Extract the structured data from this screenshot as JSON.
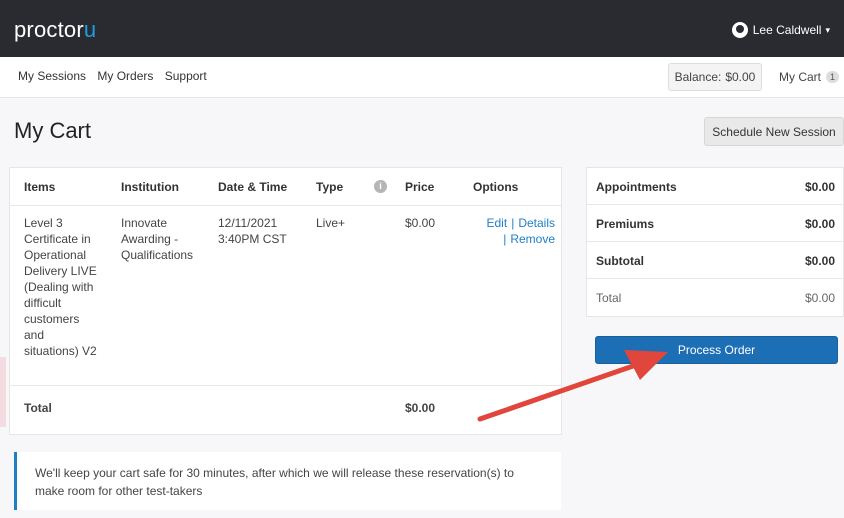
{
  "app": {
    "logo_text": "proctor",
    "logo_mark": "u",
    "user_name": "Lee Caldwell",
    "user_caret": "▾"
  },
  "nav": {
    "items": [
      "My Sessions",
      "My Orders",
      "Support"
    ],
    "balance_label": "Balance:",
    "balance_value": "$0.00",
    "cart_label": "My Cart",
    "cart_count": "1"
  },
  "page": {
    "title": "My Cart",
    "schedule_button": "Schedule New Session"
  },
  "cart_table": {
    "headers": [
      "Items",
      "Institution",
      "Date & Time",
      "Type",
      "Price",
      "Options"
    ],
    "type_info_icon": "i",
    "rows": [
      {
        "item_lines": [
          "Level 3",
          "Certificate in",
          "Operational",
          "Delivery LIVE",
          "(Dealing with",
          "difficult",
          "customers",
          "and",
          "situations) V2"
        ],
        "institution_lines": [
          "Innovate",
          "Awarding -",
          "Qualifications"
        ],
        "datetime_lines": [
          "12/11/2021",
          "3:40PM CST"
        ],
        "type": "Live+",
        "price": "$0.00",
        "options": {
          "edit": "Edit",
          "details": "Details",
          "remove": "Remove",
          "separator": "|"
        }
      }
    ],
    "total_label": "Total",
    "total_value": "$0.00"
  },
  "notice": {
    "text": "We'll keep your cart safe for 30 minutes, after which we will release these reservation(s) to make room for other test-takers"
  },
  "summary": {
    "rows": [
      {
        "label": "Appointments",
        "value": "$0.00"
      },
      {
        "label": "Premiums",
        "value": "$0.00"
      },
      {
        "label": "Subtotal",
        "value": "$0.00"
      },
      {
        "label": "Total",
        "value": "$0.00"
      }
    ],
    "process_button": "Process Order"
  },
  "colors": {
    "topbar": "#2a2a31",
    "accent": "#1d6fb5",
    "link": "#1f7fc4",
    "annotation_arrow": "#e0463b"
  },
  "icons": {
    "user": "avatar-icon",
    "info": "info-icon",
    "annotation": "red-arrow-annotation"
  }
}
